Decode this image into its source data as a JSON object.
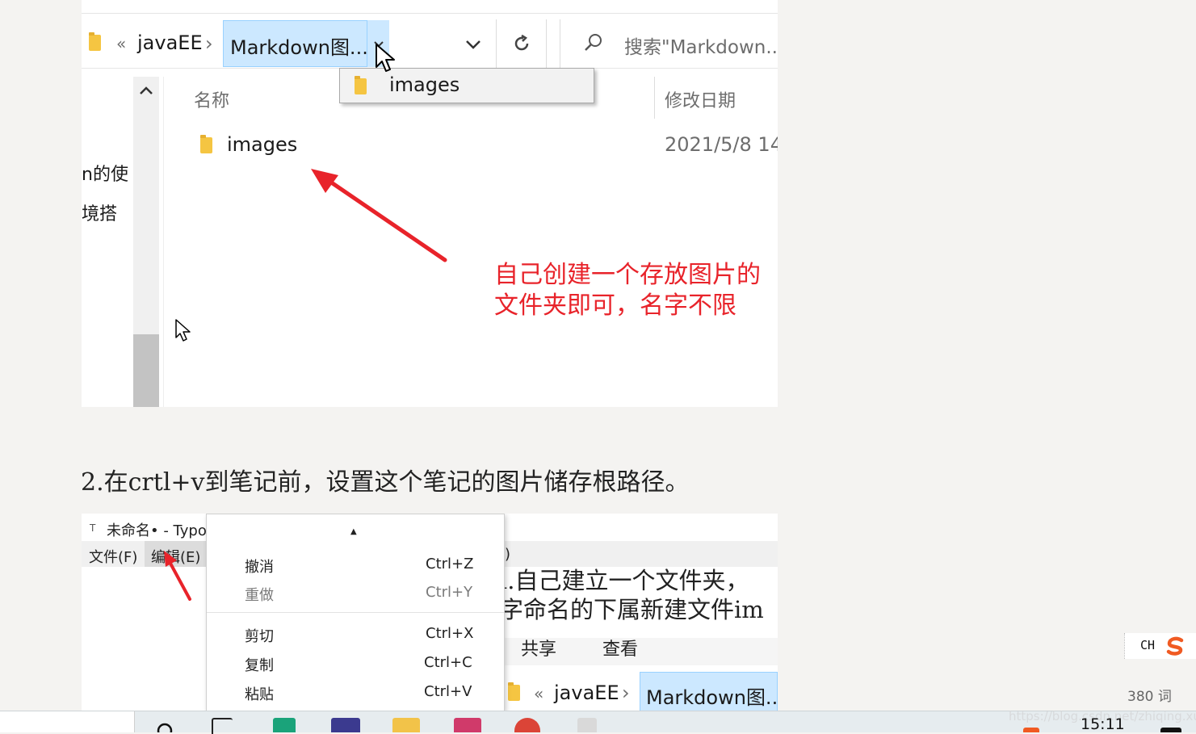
{
  "explorer_top": {
    "header_cut_text": "",
    "breadcrumb_back": "«",
    "breadcrumb_parent": "javaEE",
    "breadcrumb_sep": "›",
    "breadcrumb_current": "Markdown图...",
    "search_placeholder": "搜索\"Markdown...",
    "column_name": "名称",
    "column_date": "修改日期",
    "dropdown_item": "images",
    "file_name": "images",
    "file_date": "2021/5/8 14",
    "left_pane_items": [
      "n的使",
      "境搭"
    ],
    "annotation_line1": "自己创建一个存放图片的",
    "annotation_line2": "文件夹即可，名字不限"
  },
  "paragraph": "2.在crtl+v到笔记前，设置这个笔记的图片储存根路径。",
  "typora": {
    "title": "未命名• - Typo",
    "title_icon": "T",
    "menu_file": "文件(F)",
    "menu_edit": "编辑(E)",
    "menu_partial": ")",
    "content_line1": "l.自己建立一个文件夹，",
    "content_line2": "字命名的下属新建文件im",
    "tab_share": "共享",
    "tab_view": "查看",
    "breadcrumb_back": "«",
    "breadcrumb_parent": "javaEE",
    "breadcrumb_sep": "›",
    "breadcrumb_current": "Markdown图...",
    "context_menu": {
      "up_arrow": "▲",
      "group1": [
        {
          "label": "撤消",
          "shortcut": "Ctrl+Z",
          "disabled": false
        },
        {
          "label": "重做",
          "shortcut": "Ctrl+Y",
          "disabled": true
        }
      ],
      "group2": [
        {
          "label": "剪切",
          "shortcut": "Ctrl+X",
          "disabled": false
        },
        {
          "label": "复制",
          "shortcut": "Ctrl+C",
          "disabled": false
        },
        {
          "label": "粘贴",
          "shortcut": "Ctrl+V",
          "disabled": false
        }
      ]
    }
  },
  "status": {
    "ime_label": "CH",
    "word_count": "380 词",
    "watermark": "https://blog.csdn.net/zhiqing.xue",
    "clock": "15:11"
  },
  "colors": {
    "selection_blue": "#cce8ff",
    "annotation_red": "#e8232a",
    "folder_yellow": "#f5c542"
  }
}
